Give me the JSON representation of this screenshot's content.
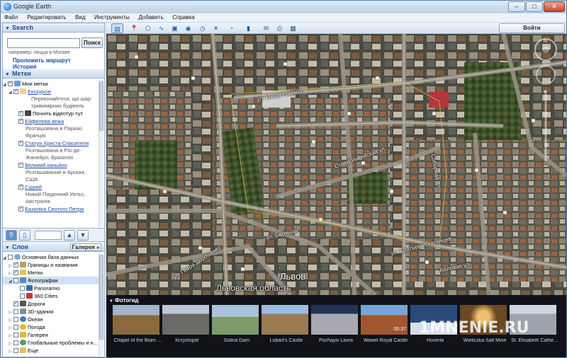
{
  "window": {
    "title": "Google Earth",
    "minimize": "–",
    "maximize": "□",
    "close": "✕"
  },
  "menu": [
    "Файл",
    "Редактировать",
    "Вид",
    "Инструменты",
    "Добавить",
    "Справка"
  ],
  "search": {
    "title": "Search",
    "input_value": "",
    "button": "Поиск",
    "hint": "например: пицца в Москве",
    "route_link": "Проложить маршрут",
    "history_link": "История"
  },
  "places": {
    "title": "Метки",
    "items": [
      {
        "label": "Мои метки",
        "type": "root"
      },
      {
        "label": "Екскурсія",
        "type": "folder",
        "desc": [
          "Переконайтеся, що шар",
          "тривимірних будівель"
        ]
      },
      {
        "label": "Почніть відеотур тут",
        "type": "tour"
      },
      {
        "label": "Ейфелева вежа",
        "type": "link",
        "desc": [
          "Розташована в Парижі,",
          "Франція"
        ]
      },
      {
        "label": "Статуя Христа Спасителя",
        "type": "link",
        "desc": [
          "Розташована в Ріо-де-",
          "Жанейро, Бразилія"
        ]
      },
      {
        "label": "Великий каньйон",
        "type": "link",
        "desc": [
          "Розташований в Арізоні,",
          "США"
        ]
      },
      {
        "label": "Сідней",
        "type": "link",
        "desc": [
          "Новий Південний Уельс,",
          "Австралія"
        ]
      },
      {
        "label": "Базиліка Святого Петра",
        "type": "link",
        "desc": []
      }
    ]
  },
  "layers": {
    "title": "Слои",
    "gallery_button": "Галерея »",
    "items": [
      {
        "label": "Основная база данных",
        "indent": 0,
        "checked": false,
        "icon": "globe"
      },
      {
        "label": "Границы и названия",
        "indent": 1,
        "checked": true,
        "icon": "borders"
      },
      {
        "label": "Метки",
        "indent": 1,
        "checked": true,
        "icon": "places"
      },
      {
        "label": "Фотографии",
        "indent": 1,
        "checked": false,
        "icon": "photo",
        "selected": true
      },
      {
        "label": "Panoramio",
        "indent": 2,
        "checked": false,
        "icon": "panoramio"
      },
      {
        "label": "360 Cities",
        "indent": 2,
        "checked": false,
        "icon": "cities"
      },
      {
        "label": "Дороги",
        "indent": 1,
        "checked": true,
        "icon": "roads"
      },
      {
        "label": "3D-здания",
        "indent": 1,
        "checked": false,
        "icon": "buildings"
      },
      {
        "label": "Океан",
        "indent": 1,
        "checked": false,
        "icon": "ocean"
      },
      {
        "label": "Погода",
        "indent": 1,
        "checked": false,
        "icon": "weather"
      },
      {
        "label": "Галерея",
        "indent": 1,
        "checked": false,
        "icon": "gallery"
      },
      {
        "label": "Глобальные проблемы и н...",
        "indent": 1,
        "checked": false,
        "icon": "global"
      },
      {
        "label": "Еще",
        "indent": 1,
        "checked": false,
        "icon": "more"
      }
    ]
  },
  "toolbar": {
    "signin": "Войти"
  },
  "map": {
    "city": "Львов",
    "region": "Львовская область",
    "streets": [
      "ул. Князя Романа",
      "ул. Бериндьі",
      "ул. Ивана Франко",
      "Ставропигийская ул.",
      "ул. Петра Дорошенко",
      "ул. Братьев Рогатинцев",
      "Валовая ул.",
      "Лесная ул.",
      "Соборная пл."
    ]
  },
  "photos": {
    "title": "Фотогид",
    "items": [
      {
        "caption": "Chapel of the Boim ...",
        "color": "#8a6a3c"
      },
      {
        "caption": "Krzyztopór",
        "color": "#6c6a66"
      },
      {
        "caption": "Solina Dam",
        "color": "#7d9b6a"
      },
      {
        "caption": "Lubart's Castle",
        "color": "#9a7b52"
      },
      {
        "caption": "Pochayiv Lavra",
        "color": "#a8a9b0"
      },
      {
        "caption": "Wawel Royal Castle",
        "color": "#a0562f",
        "duration": "00:37"
      },
      {
        "caption": "Hoverla",
        "color": "#2a4a7a"
      },
      {
        "caption": "Wieliczka Salt Mine",
        "color": "#6a4a24"
      },
      {
        "caption": "St. Elisabeth Cathe...",
        "color": "#9ea4ad"
      }
    ]
  },
  "watermark": "1MNENIE.RU"
}
